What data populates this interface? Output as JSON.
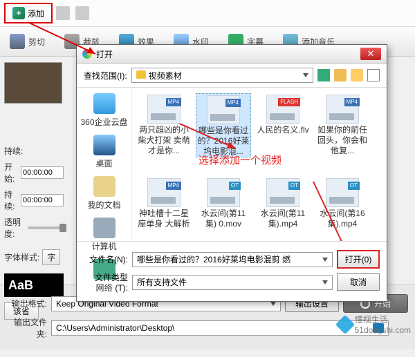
{
  "toolbar": {
    "add_label": "添加"
  },
  "tabs": {
    "cut": "剪切",
    "crop": "裁剪",
    "fx": "效果",
    "wm": "水印",
    "sub": "字幕",
    "music": "添加音乐"
  },
  "left": {
    "duration_label": "持续:",
    "start_label": "开始:",
    "start_value": "00:00:00",
    "len_label": "持续:",
    "len_value": "00:00:00",
    "opacity_label": "透明度:",
    "fontstyle_label": "字体样式:",
    "fontbtn": "字",
    "preview_text": "AaB",
    "advance_btn": "该省"
  },
  "bottom": {
    "format_label": "输出格式:",
    "format_value": "Keep Original Video Format",
    "settings_btn": "输出设置",
    "start_btn": "开始",
    "folder_label": "输出文件夹:",
    "folder_value": "C:\\Users\\Administrator\\Desktop\\"
  },
  "dialog": {
    "title": "打开",
    "scope_label": "查找范围(I):",
    "scope_value": "视频素材",
    "side": {
      "cloud": "360企业云盘",
      "desktop": "桌面",
      "docs": "我的文档",
      "pc": "计算机",
      "net": "网络"
    },
    "files_row1": [
      {
        "name": "两只超凶的小柴犬打架 卖萌才是你...",
        "tag": "MP4"
      },
      {
        "name": "哪些是你看过的？2016好莱坞电影混...",
        "tag": "MP4",
        "selected": true
      },
      {
        "name": "人民的名义.flv",
        "tag": "FLASH",
        "flash": true
      },
      {
        "name": "如果你的前任回头，你会和他复...",
        "tag": "MP4"
      }
    ],
    "files_row2": [
      {
        "name": "神吐槽十二星座单身 大解析",
        "tag": "MP4"
      },
      {
        "name": "水云间(第11集) 0.mov",
        "tag": "OT",
        "ot": true
      },
      {
        "name": "水云间(第11集).mp4",
        "tag": "OT",
        "ot": true
      },
      {
        "name": "水云间(第16集).mp4",
        "tag": "OT",
        "ot": true
      }
    ],
    "annotation": "选择添加一个视频",
    "filename_label": "文件名(N):",
    "filename_value": "哪些是你看过的？2016好莱坞电影混剪 燃",
    "filetype_label": "文件类型(T):",
    "filetype_value": "所有支持文件",
    "open_btn": "打开(0)",
    "cancel_btn": "取消"
  },
  "watermark": {
    "text": "懂视生活",
    "domain": "51dongshi.com"
  }
}
